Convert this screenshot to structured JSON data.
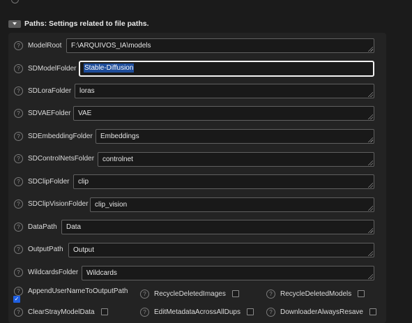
{
  "section": {
    "title": "Paths: Settings related to file paths."
  },
  "fields": [
    {
      "label": "ModelRoot",
      "value": "F:\\ARQUIVOS_IA\\models"
    },
    {
      "label": "SDModelFolder",
      "value": "Stable-Diffusion"
    },
    {
      "label": "SDLoraFolder",
      "value": "loras"
    },
    {
      "label": "SDVAEFolder",
      "value": "VAE"
    },
    {
      "label": "SDEmbeddingFolder",
      "value": "Embeddings"
    },
    {
      "label": "SDControlNetsFolder",
      "value": "controlnet"
    },
    {
      "label": "SDClipFolder",
      "value": "clip"
    },
    {
      "label": "SDClipVisionFolder",
      "value": "clip_vision"
    },
    {
      "label": "DataPath",
      "value": "Data"
    },
    {
      "label": "OutputPath",
      "value": "Output"
    },
    {
      "label": "WildcardsFolder",
      "value": "Wildcards"
    }
  ],
  "checkboxes": [
    {
      "label": "AppendUserNameToOutputPath",
      "checked": true
    },
    {
      "label": "RecycleDeletedImages",
      "checked": false
    },
    {
      "label": "RecycleDeletedModels",
      "checked": false
    },
    {
      "label": "ClearStrayModelData",
      "checked": false
    },
    {
      "label": "EditMetadataAcrossAllDups",
      "checked": false
    },
    {
      "label": "DownloaderAlwaysResave",
      "checked": false
    }
  ],
  "colors": {
    "background": "#1b1b1b",
    "panel": "#232323",
    "input_bg": "#191919",
    "selection": "#1e4c9a",
    "checkbox_checked": "#1f5fe0"
  },
  "icons": {
    "help": "?",
    "checkmark": "✓"
  }
}
